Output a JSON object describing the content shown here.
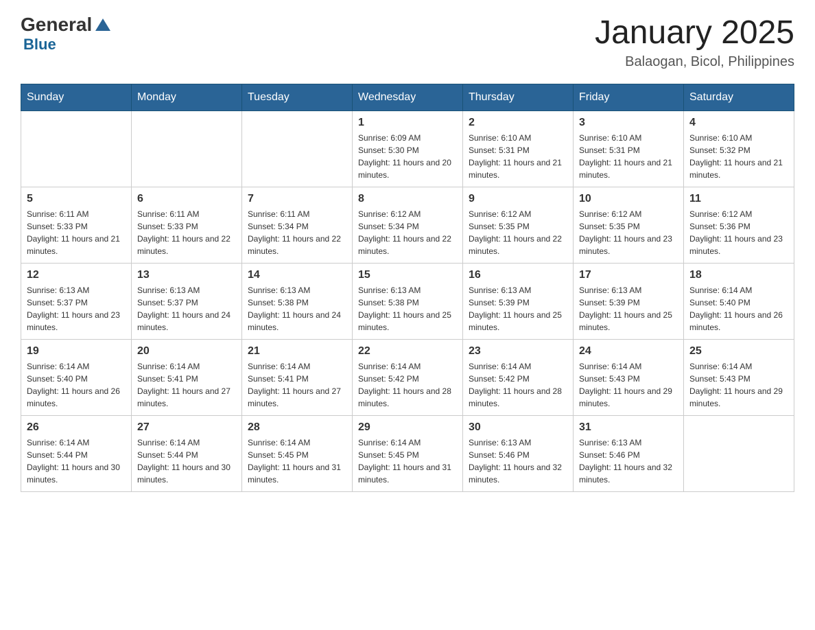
{
  "logo": {
    "general": "General",
    "triangle": "▲",
    "blue": "Blue"
  },
  "title": "January 2025",
  "subtitle": "Balaogan, Bicol, Philippines",
  "headers": [
    "Sunday",
    "Monday",
    "Tuesday",
    "Wednesday",
    "Thursday",
    "Friday",
    "Saturday"
  ],
  "weeks": [
    [
      {
        "day": "",
        "info": ""
      },
      {
        "day": "",
        "info": ""
      },
      {
        "day": "",
        "info": ""
      },
      {
        "day": "1",
        "info": "Sunrise: 6:09 AM\nSunset: 5:30 PM\nDaylight: 11 hours and 20 minutes."
      },
      {
        "day": "2",
        "info": "Sunrise: 6:10 AM\nSunset: 5:31 PM\nDaylight: 11 hours and 21 minutes."
      },
      {
        "day": "3",
        "info": "Sunrise: 6:10 AM\nSunset: 5:31 PM\nDaylight: 11 hours and 21 minutes."
      },
      {
        "day": "4",
        "info": "Sunrise: 6:10 AM\nSunset: 5:32 PM\nDaylight: 11 hours and 21 minutes."
      }
    ],
    [
      {
        "day": "5",
        "info": "Sunrise: 6:11 AM\nSunset: 5:33 PM\nDaylight: 11 hours and 21 minutes."
      },
      {
        "day": "6",
        "info": "Sunrise: 6:11 AM\nSunset: 5:33 PM\nDaylight: 11 hours and 22 minutes."
      },
      {
        "day": "7",
        "info": "Sunrise: 6:11 AM\nSunset: 5:34 PM\nDaylight: 11 hours and 22 minutes."
      },
      {
        "day": "8",
        "info": "Sunrise: 6:12 AM\nSunset: 5:34 PM\nDaylight: 11 hours and 22 minutes."
      },
      {
        "day": "9",
        "info": "Sunrise: 6:12 AM\nSunset: 5:35 PM\nDaylight: 11 hours and 22 minutes."
      },
      {
        "day": "10",
        "info": "Sunrise: 6:12 AM\nSunset: 5:35 PM\nDaylight: 11 hours and 23 minutes."
      },
      {
        "day": "11",
        "info": "Sunrise: 6:12 AM\nSunset: 5:36 PM\nDaylight: 11 hours and 23 minutes."
      }
    ],
    [
      {
        "day": "12",
        "info": "Sunrise: 6:13 AM\nSunset: 5:37 PM\nDaylight: 11 hours and 23 minutes."
      },
      {
        "day": "13",
        "info": "Sunrise: 6:13 AM\nSunset: 5:37 PM\nDaylight: 11 hours and 24 minutes."
      },
      {
        "day": "14",
        "info": "Sunrise: 6:13 AM\nSunset: 5:38 PM\nDaylight: 11 hours and 24 minutes."
      },
      {
        "day": "15",
        "info": "Sunrise: 6:13 AM\nSunset: 5:38 PM\nDaylight: 11 hours and 25 minutes."
      },
      {
        "day": "16",
        "info": "Sunrise: 6:13 AM\nSunset: 5:39 PM\nDaylight: 11 hours and 25 minutes."
      },
      {
        "day": "17",
        "info": "Sunrise: 6:13 AM\nSunset: 5:39 PM\nDaylight: 11 hours and 25 minutes."
      },
      {
        "day": "18",
        "info": "Sunrise: 6:14 AM\nSunset: 5:40 PM\nDaylight: 11 hours and 26 minutes."
      }
    ],
    [
      {
        "day": "19",
        "info": "Sunrise: 6:14 AM\nSunset: 5:40 PM\nDaylight: 11 hours and 26 minutes."
      },
      {
        "day": "20",
        "info": "Sunrise: 6:14 AM\nSunset: 5:41 PM\nDaylight: 11 hours and 27 minutes."
      },
      {
        "day": "21",
        "info": "Sunrise: 6:14 AM\nSunset: 5:41 PM\nDaylight: 11 hours and 27 minutes."
      },
      {
        "day": "22",
        "info": "Sunrise: 6:14 AM\nSunset: 5:42 PM\nDaylight: 11 hours and 28 minutes."
      },
      {
        "day": "23",
        "info": "Sunrise: 6:14 AM\nSunset: 5:42 PM\nDaylight: 11 hours and 28 minutes."
      },
      {
        "day": "24",
        "info": "Sunrise: 6:14 AM\nSunset: 5:43 PM\nDaylight: 11 hours and 29 minutes."
      },
      {
        "day": "25",
        "info": "Sunrise: 6:14 AM\nSunset: 5:43 PM\nDaylight: 11 hours and 29 minutes."
      }
    ],
    [
      {
        "day": "26",
        "info": "Sunrise: 6:14 AM\nSunset: 5:44 PM\nDaylight: 11 hours and 30 minutes."
      },
      {
        "day": "27",
        "info": "Sunrise: 6:14 AM\nSunset: 5:44 PM\nDaylight: 11 hours and 30 minutes."
      },
      {
        "day": "28",
        "info": "Sunrise: 6:14 AM\nSunset: 5:45 PM\nDaylight: 11 hours and 31 minutes."
      },
      {
        "day": "29",
        "info": "Sunrise: 6:14 AM\nSunset: 5:45 PM\nDaylight: 11 hours and 31 minutes."
      },
      {
        "day": "30",
        "info": "Sunrise: 6:13 AM\nSunset: 5:46 PM\nDaylight: 11 hours and 32 minutes."
      },
      {
        "day": "31",
        "info": "Sunrise: 6:13 AM\nSunset: 5:46 PM\nDaylight: 11 hours and 32 minutes."
      },
      {
        "day": "",
        "info": ""
      }
    ]
  ]
}
